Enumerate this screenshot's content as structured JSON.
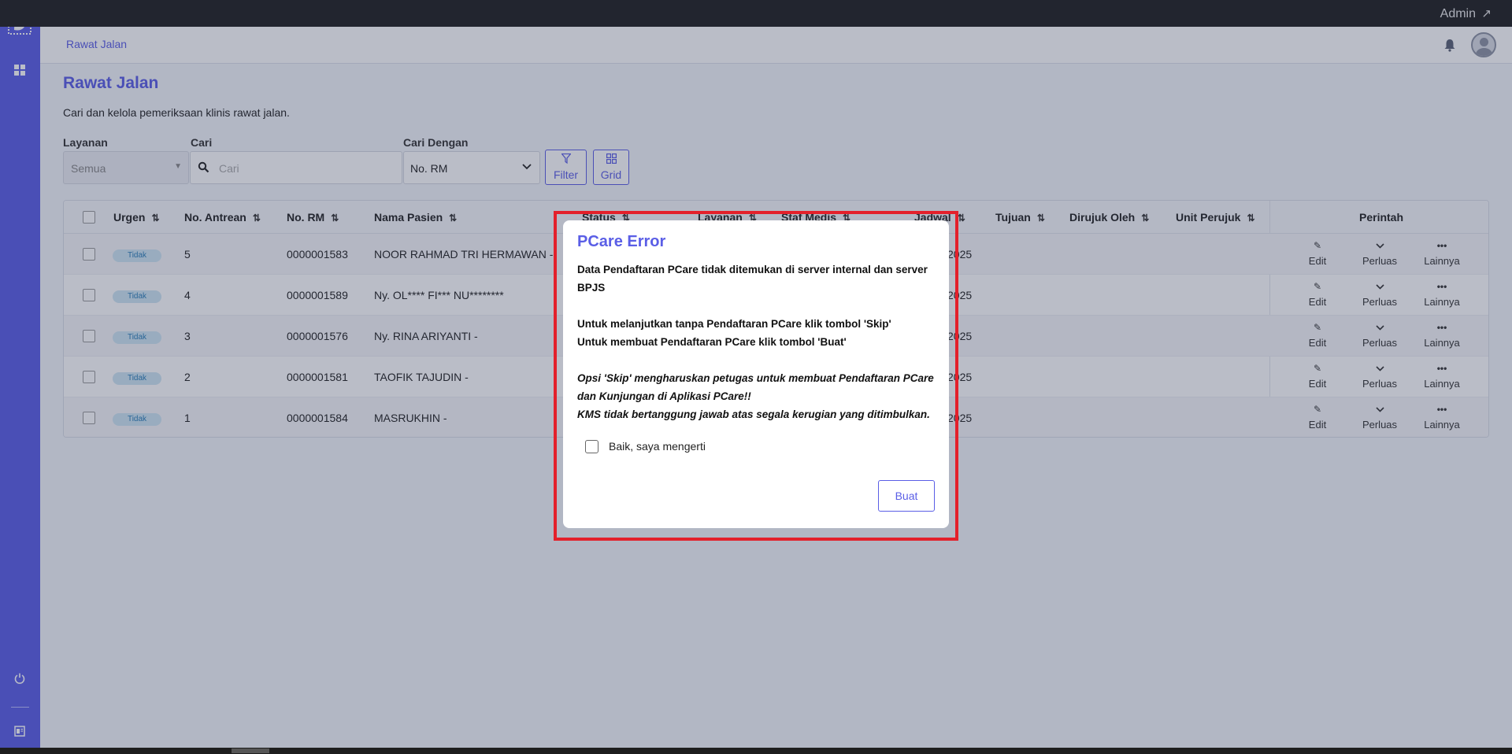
{
  "app": {
    "user_label": "Admin"
  },
  "header": {
    "breadcrumb": "Rawat Jalan"
  },
  "page": {
    "title": "Rawat Jalan",
    "subtitle": "Cari dan kelola pemeriksaan klinis rawat jalan."
  },
  "filters": {
    "layanan_label": "Layanan",
    "layanan_value": "Semua",
    "cari_label": "Cari",
    "cari_placeholder": "Cari",
    "cari_dengan_label": "Cari Dengan",
    "cari_dengan_value": "No. RM",
    "filter_button": "Filter",
    "grid_button": "Grid"
  },
  "table": {
    "columns": {
      "urgen": "Urgen",
      "antrean": "No. Antrean",
      "rm": "No. RM",
      "nama": "Nama Pasien",
      "status": "Status",
      "layanan": "Layanan",
      "staf": "Staf Medis",
      "jadwal": "Jadwal",
      "tujuan": "Tujuan",
      "dirujuk": "Dirujuk Oleh",
      "unit": "Unit Perujuk",
      "perintah": "Perintah"
    },
    "rows": [
      {
        "urgen": "Tidak",
        "antrean": "5",
        "rm": "0000001583",
        "nama": "NOOR RAHMAD TRI HERMAWAN -",
        "jadwal": "2025"
      },
      {
        "urgen": "Tidak",
        "antrean": "4",
        "rm": "0000001589",
        "nama": "Ny. OL**** FI*** NU********",
        "jadwal": "2025"
      },
      {
        "urgen": "Tidak",
        "antrean": "3",
        "rm": "0000001576",
        "nama": "Ny. RINA ARIYANTI -",
        "jadwal": "2025"
      },
      {
        "urgen": "Tidak",
        "antrean": "2",
        "rm": "0000001581",
        "nama": "TAOFIK TAJUDIN -",
        "jadwal": "2025"
      },
      {
        "urgen": "Tidak",
        "antrean": "1",
        "rm": "0000001584",
        "nama": "MASRUKHIN -",
        "jadwal": "2025"
      }
    ],
    "actions": {
      "edit": "Edit",
      "perluas": "Perluas",
      "lainnya": "Lainnya"
    }
  },
  "modal": {
    "title": "PCare Error",
    "line1": "Data Pendaftaran PCare tidak ditemukan di server internal dan server BPJS",
    "line2": "Untuk melanjutkan tanpa Pendaftaran PCare klik tombol 'Skip'",
    "line3": "Untuk membuat Pendaftaran PCare klik tombol 'Buat'",
    "italic1": "Opsi 'Skip' mengharuskan petugas untuk membuat Pendaftaran PCare dan Kunjungan di Aplikasi PCare!!",
    "italic2": "KMS tidak bertanggung jawab atas segala kerugian yang ditimbulkan.",
    "checkbox_label": "Baik, saya mengerti",
    "button": "Buat"
  },
  "colors": {
    "accent": "#5a5ee6",
    "highlight": "#e3202b",
    "badge_bg": "#cfe6f4"
  },
  "icons": {
    "sidebar": [
      "logo-icon",
      "grid-icon",
      "power-icon",
      "report-icon"
    ],
    "header": [
      "bell-icon",
      "avatar-icon"
    ],
    "actions": [
      "pencil-icon",
      "chevron-down-icon",
      "ellipsis-icon"
    ]
  }
}
